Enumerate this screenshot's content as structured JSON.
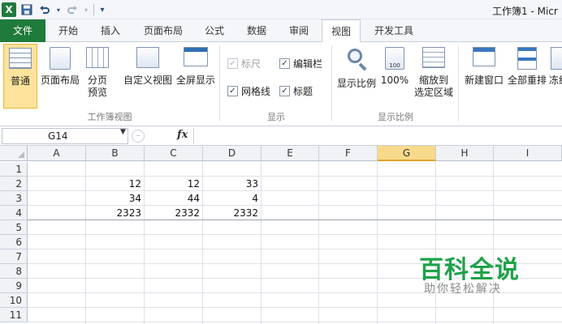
{
  "titlebar": {
    "title": "工作簿1 - Micr",
    "app_icon": "X"
  },
  "qat": {
    "save_icon": "save-icon",
    "undo_icon": "undo-icon",
    "redo_icon": "redo-icon"
  },
  "tabs": [
    {
      "label": "文件"
    },
    {
      "label": "开始"
    },
    {
      "label": "插入"
    },
    {
      "label": "页面布局"
    },
    {
      "label": "公式"
    },
    {
      "label": "数据"
    },
    {
      "label": "审阅"
    },
    {
      "label": "视图"
    },
    {
      "label": "开发工具"
    }
  ],
  "active_tab": "视图",
  "ribbon": {
    "workbook_views": {
      "label": "工作簿视图",
      "normal": "普通",
      "page_layout": "页面布局",
      "page_break_1": "分页",
      "page_break_2": "预览",
      "custom_views": "自定义视图",
      "full_screen": "全屏显示"
    },
    "show": {
      "label": "显示",
      "ruler": "标尺",
      "formula_bar": "编辑栏",
      "gridlines": "网格线",
      "headings": "标题"
    },
    "zoom": {
      "label": "显示比例",
      "zoom": "显示比例",
      "zoom_100": "100%",
      "zoom_sel_1": "缩放到",
      "zoom_sel_2": "选定区域"
    },
    "window": {
      "new_window": "新建窗口",
      "arrange_all": "全部重排",
      "freeze": "冻结"
    }
  },
  "formula_bar": {
    "name_box": "G14",
    "fx": "fx"
  },
  "sheet": {
    "columns": [
      "A",
      "B",
      "C",
      "D",
      "E",
      "F",
      "G",
      "H",
      "I"
    ],
    "rows": [
      "1",
      "2",
      "3",
      "4",
      "5",
      "6",
      "7",
      "8",
      "9",
      "10",
      "11"
    ],
    "cells": {
      "B2": "12",
      "C2": "12",
      "D2": "33",
      "B3": "34",
      "C3": "44",
      "D3": "4",
      "B4": "2323",
      "C4": "2332",
      "D4": "2332"
    },
    "selected_column": "G"
  },
  "watermark": {
    "main": "百科全说",
    "sub": "助你轻松解决"
  }
}
